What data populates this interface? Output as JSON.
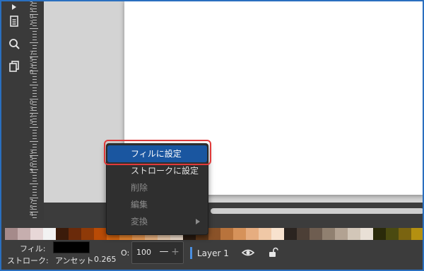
{
  "toolbox": {
    "tools": [
      "document-icon",
      "zoom-icon",
      "clone-icon"
    ]
  },
  "ruler": {
    "labels": [
      "2",
      "5",
      "0",
      "2",
      "7",
      "5",
      "3",
      "0",
      "0",
      "3",
      "2",
      "5",
      "3",
      "5",
      "0",
      "3",
      "7",
      "5",
      "4",
      "0"
    ]
  },
  "context_menu": {
    "items": [
      {
        "label": "フィルに設定",
        "state": "selected"
      },
      {
        "label": "ストロークに設定",
        "state": "enabled"
      },
      {
        "label": "削除",
        "state": "disabled"
      },
      {
        "label": "編集",
        "state": "disabled"
      },
      {
        "label": "変換",
        "state": "disabled",
        "submenu": true
      }
    ]
  },
  "palette": {
    "colors": [
      "#a58a8a",
      "#c6aeae",
      "#e7d7d7",
      "#f2f2f2",
      "#3b1b0a",
      "#6a2a0a",
      "#8f3a08",
      "#b94b06",
      "#e06a10",
      "#f08a30",
      "#f7a35a",
      "#f9bf8a",
      "#fad8b8",
      "#fbe8d6",
      "#2a1b10",
      "#5a3518",
      "#8a5228",
      "#b8733c",
      "#d6925a",
      "#e6ad80",
      "#f0c8a6",
      "#f8e2ce",
      "#2b2420",
      "#4c3f36",
      "#6e5d50",
      "#908070",
      "#b2a292",
      "#d2c6b8",
      "#e9e0d6",
      "#2a2a0a",
      "#4a4a10",
      "#7a6410",
      "#b49010"
    ]
  },
  "status": {
    "fill_label": "フィル:",
    "stroke_label": "ストローク:",
    "stroke_value": "アンセット",
    "stroke_width": "0.265",
    "opacity_label": "O:",
    "opacity_value": "100",
    "layer_name": "Layer 1"
  }
}
